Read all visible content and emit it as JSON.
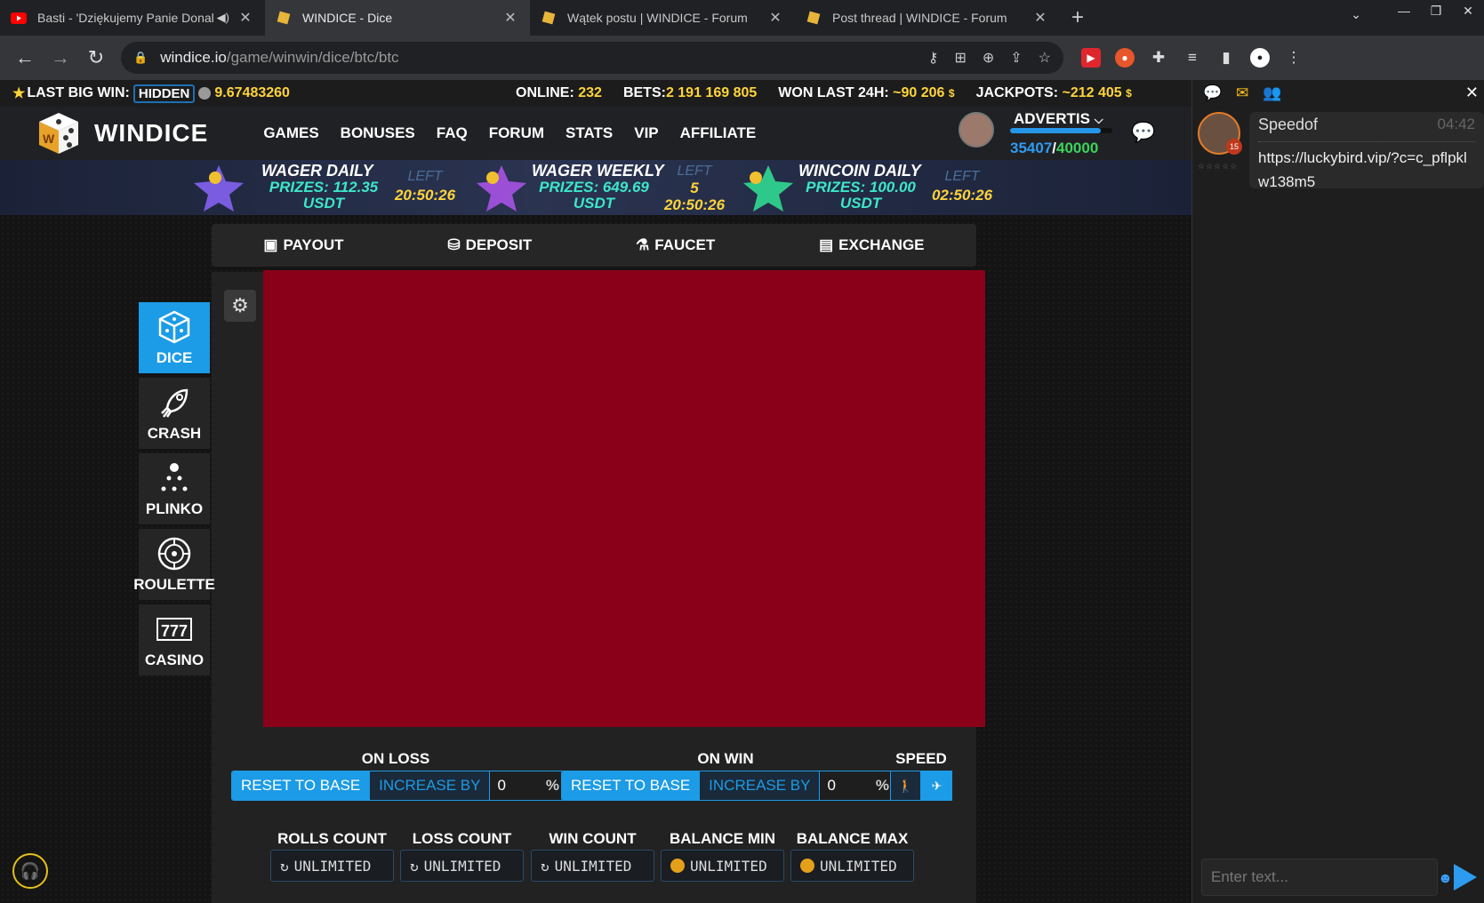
{
  "browser": {
    "tabs": [
      {
        "title": "Basti - 'Dziękujemy Panie Donal",
        "favicon": "youtube-icon",
        "audio": true
      },
      {
        "title": "WINDICE - Dice",
        "favicon": "windice-icon",
        "active": true
      },
      {
        "title": "Wątek postu | WINDICE - Forum",
        "favicon": "windice-icon"
      },
      {
        "title": "Post thread | WINDICE - Forum",
        "favicon": "windice-icon"
      }
    ],
    "url_host": "windice.io",
    "url_path": "/game/winwin/dice/btc/btc"
  },
  "infobar": {
    "last_big_win_label": "LAST BIG WIN:",
    "hidden_label": "HIDDEN",
    "last_big_win_value": "9.67483260",
    "online_label": "ONLINE:",
    "online_value": "232",
    "bets_label": "BETS:",
    "bets_value": "2 191 169 805",
    "won_label": "WON LAST 24H:",
    "won_value": "~90 206",
    "jackpots_label": "JACKPOTS:",
    "jackpots_value": "~212 405",
    "currency_symbol": "$"
  },
  "header": {
    "logo": "WINDICE",
    "nav": [
      "GAMES",
      "BONUSES",
      "FAQ",
      "FORUM",
      "STATS",
      "VIP",
      "AFFILIATE"
    ],
    "username": "ADVERTIS",
    "xp_current": "35407",
    "xp_sep": "/",
    "xp_total": "40000",
    "xp_progress": 0.885
  },
  "contests": [
    {
      "title": "WAGER DAILY",
      "prize_line1": "PRIZES: 112.35",
      "prize_line2": "USDT",
      "left_label": "LEFT",
      "timer": "20:50:26",
      "timer_days": "",
      "color": "#7a5ce0"
    },
    {
      "title": "WAGER WEEKLY",
      "prize_line1": "PRIZES: 649.69",
      "prize_line2": "USDT",
      "left_label": "LEFT",
      "timer": "20:50:26",
      "timer_days": "5",
      "color": "#9b4fd6"
    },
    {
      "title": "WINCOIN DAILY",
      "prize_line1": "PRIZES: 100.00",
      "prize_line2": "USDT",
      "left_label": "LEFT",
      "timer": "02:50:26",
      "timer_days": "",
      "color": "#2ec98a"
    }
  ],
  "subnav": [
    "PAYOUT",
    "DEPOSIT",
    "FAUCET",
    "EXCHANGE"
  ],
  "side_games": [
    "DICE",
    "CRASH",
    "PLINKO",
    "ROULETTE",
    "CASINO"
  ],
  "auto": {
    "on_loss_label": "ON LOSS",
    "on_win_label": "ON WIN",
    "speed_label": "SPEED",
    "reset_label": "RESET TO BASE",
    "increase_label": "INCREASE BY",
    "on_loss_value": "0",
    "on_win_value": "0",
    "percent": "%",
    "limits": [
      {
        "label": "ROLLS COUNT",
        "value": "UNLIMITED"
      },
      {
        "label": "LOSS COUNT",
        "value": "UNLIMITED"
      },
      {
        "label": "WIN COUNT",
        "value": "UNLIMITED"
      },
      {
        "label": "BALANCE MIN",
        "value": "UNLIMITED"
      },
      {
        "label": "BALANCE MAX",
        "value": "UNLIMITED"
      }
    ]
  },
  "chat": {
    "message": {
      "user": "Speedof",
      "time": "04:42",
      "text": "https://luckybird.vip/?c=c_pflpklw138m5",
      "level": "15"
    },
    "input_placeholder": "Enter text..."
  },
  "colors": {
    "accent": "#1c9be6",
    "gold": "#ffd43b",
    "game_area": "#8a0019",
    "prize": "#3ee6c8"
  }
}
